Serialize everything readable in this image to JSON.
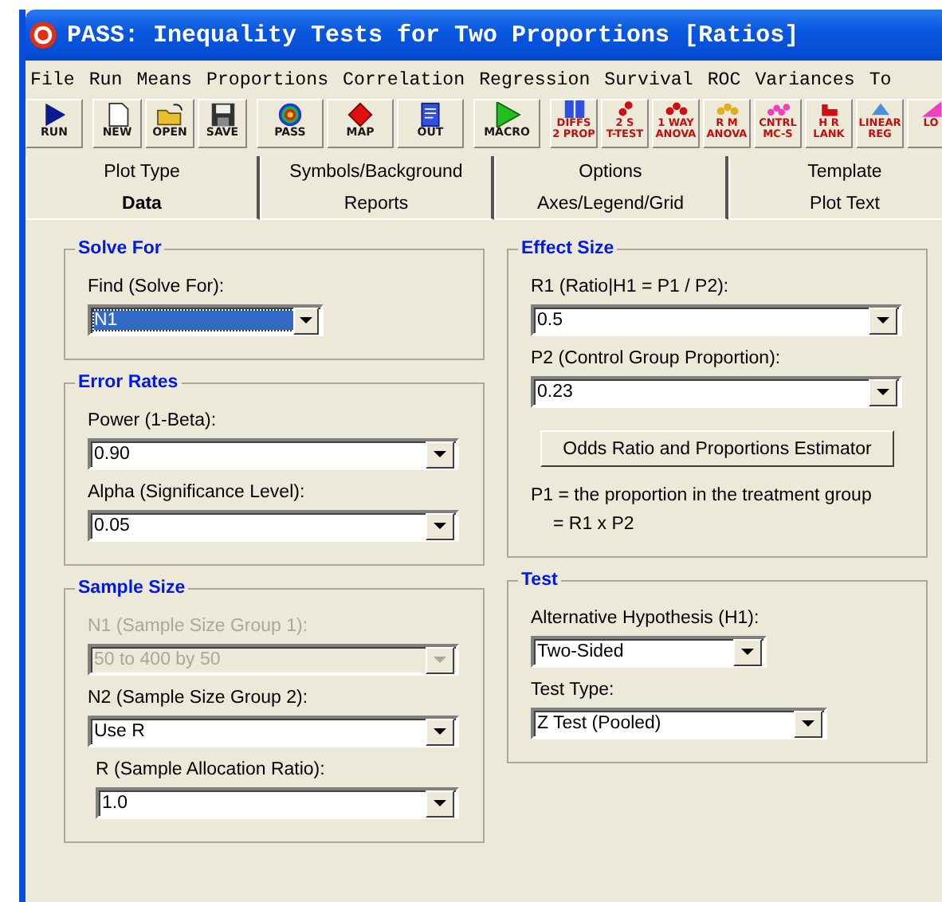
{
  "window": {
    "title": "PASS: Inequality Tests for Two Proportions [Ratios]"
  },
  "menu": [
    "File",
    "Run",
    "Means",
    "Proportions",
    "Correlation",
    "Regression",
    "Survival",
    "ROC",
    "Variances",
    "To"
  ],
  "toolbar": [
    {
      "kind": "file",
      "buttons": [
        {
          "kind": "run",
          "label": [
            "RUN"
          ]
        }
      ]
    },
    {
      "kind": "file",
      "buttons": [
        {
          "kind": "new",
          "label": [
            "NEW"
          ]
        },
        {
          "kind": "open",
          "label": [
            "OPEN"
          ]
        },
        {
          "kind": "save",
          "label": [
            "SAVE"
          ]
        }
      ]
    },
    {
      "kind": "file",
      "buttons": [
        {
          "kind": "pass",
          "label": [
            "PASS"
          ]
        },
        {
          "kind": "map",
          "label": [
            "MAP"
          ]
        },
        {
          "kind": "out",
          "label": [
            "OUT"
          ]
        }
      ]
    },
    {
      "kind": "file",
      "buttons": [
        {
          "kind": "macro",
          "label": [
            "MACRO"
          ]
        }
      ]
    },
    {
      "kind": "stats",
      "buttons": [
        {
          "kind": "bars",
          "label": [
            "DIFFS",
            "2 PROP"
          ]
        },
        {
          "kind": "two-dots",
          "label": [
            "2 S",
            "T-TEST"
          ]
        },
        {
          "kind": "three-dots",
          "label": [
            "1 WAY",
            "ANOVA"
          ]
        },
        {
          "kind": "yellow-dots",
          "label": [
            "R M",
            "ANOVA"
          ]
        },
        {
          "kind": "four-dots",
          "label": [
            "CNTRL",
            "MC-S"
          ]
        },
        {
          "kind": "steps",
          "label": [
            "H R",
            "LANK"
          ]
        },
        {
          "kind": "triangle",
          "label": [
            "LINEAR",
            "REG"
          ]
        },
        {
          "kind": "wedge",
          "label": [
            "LO"
          ]
        }
      ]
    }
  ],
  "tab_rows": [
    [
      {
        "label": "Plot Type",
        "selected": false
      },
      {
        "label": "Symbols/Background",
        "selected": false
      },
      {
        "label": "Options",
        "selected": false
      },
      {
        "label": "Template",
        "selected": false
      }
    ],
    [
      {
        "label": "Data",
        "selected": true
      },
      {
        "label": "Reports",
        "selected": false
      },
      {
        "label": "Axes/Legend/Grid",
        "selected": false
      },
      {
        "label": "Plot Text",
        "selected": false
      }
    ]
  ],
  "left_panel": [
    {
      "title": "Solve For",
      "items": [
        {
          "kind": "short-combo",
          "label": "Find (Solve For):",
          "value": "N1",
          "focused": true,
          "disabled": false
        }
      ]
    },
    {
      "title": "Error Rates",
      "items": [
        {
          "kind": "combo",
          "label": "Power (1-Beta):",
          "value": "0.90",
          "focused": false,
          "disabled": false
        },
        {
          "kind": "combo",
          "label": "Alpha (Significance Level):",
          "value": "0.05",
          "focused": false,
          "disabled": false
        }
      ]
    },
    {
      "title": "Sample Size",
      "items": [
        {
          "kind": "combo",
          "label": "N1 (Sample Size Group 1):",
          "value": "50 to 400 by 50",
          "focused": false,
          "disabled": true
        },
        {
          "kind": "combo",
          "label": "N2 (Sample Size Group 2):",
          "value": "Use R",
          "focused": false,
          "disabled": false,
          "children": [
            {
              "kind": "combo",
              "label": "R (Sample Allocation Ratio):",
              "value": "1.0",
              "focused": false,
              "disabled": false
            }
          ]
        }
      ]
    }
  ],
  "right_panel": [
    {
      "title": "Effect Size",
      "items": [
        {
          "kind": "combo",
          "label": "R1 (Ratio|H1 = P1 / P2):",
          "value": "0.5",
          "focused": false,
          "disabled": false
        },
        {
          "kind": "combo",
          "label": "P2 (Control Group Proportion):",
          "value": "0.23",
          "focused": false,
          "disabled": false
        },
        {
          "kind": "button",
          "label": "Odds Ratio and Proportions Estimator"
        },
        {
          "kind": "note",
          "lines": [
            "P1 = the proportion in the treatment group",
            "= R1 x P2"
          ]
        }
      ]
    },
    {
      "title": "Test",
      "items": [
        {
          "kind": "short-combo",
          "label": "Alternative Hypothesis (H1):",
          "value": "Two-Sided",
          "focused": false,
          "disabled": false
        },
        {
          "kind": "medium-combo",
          "label": "Test Type:",
          "value": "Z Test (Pooled)",
          "focused": false,
          "disabled": false
        }
      ]
    }
  ]
}
